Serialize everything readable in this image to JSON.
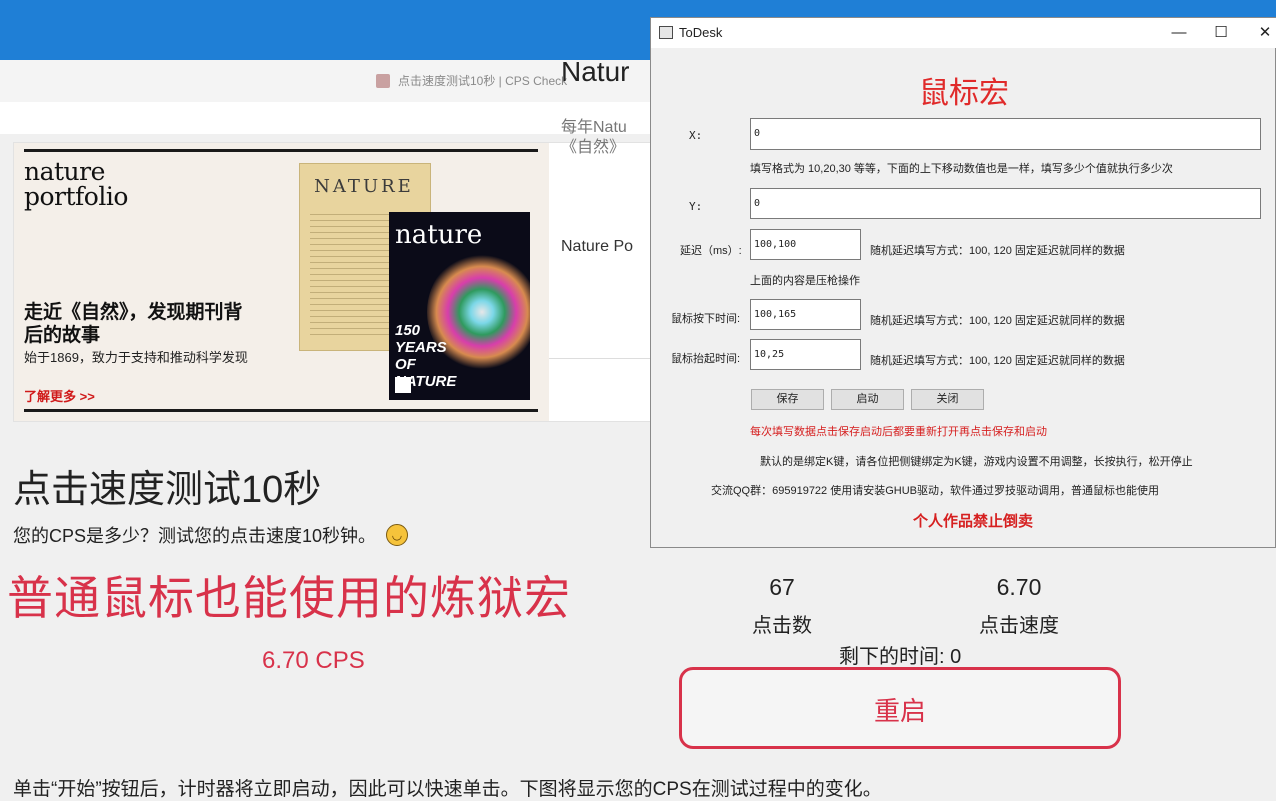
{
  "browser": {
    "tab_title": "点击速度测试10秒 | CPS Check"
  },
  "ad": {
    "logo_line1": "nature",
    "logo_line2": "portfolio",
    "headline": "走近《自然》，发现期刊背后的故事",
    "subtext": "始于1869，致力于支持和推动科学发现",
    "cta": "了解更多 >>",
    "old_cover_mast": "NATURE",
    "new_cover_logo": "nature",
    "new_cover_text": "150 YEARS OF NATURE",
    "right_title": "Natur",
    "right_sub_line1": "每年Natu",
    "right_sub_line2": "《自然》",
    "right_footer": "Nature Po"
  },
  "cps": {
    "title": "点击速度测试10秒",
    "description": "您的CPS是多少？测试您的点击速度10秒钟。",
    "overlay_text": "普通鼠标也能使用的炼狱宏",
    "result": "6.70 CPS",
    "clicks_value": "67",
    "clicks_label": "点击数",
    "speed_value": "6.70",
    "speed_label": "点击速度",
    "remaining": "剩下的时间: 0",
    "restart_label": "重启",
    "footer": "单击“开始”按钮后，计时器将立即启动，因此可以快速单击。下图将显示您的CPS在测试过程中的变化。"
  },
  "dialog": {
    "title": "ToDesk",
    "minimize": "—",
    "maximize": "☐",
    "close": "✕",
    "heading": "鼠标宏",
    "x_label": "X:",
    "x_value": "0",
    "x_hint": "填写格式为 10,20,30 等等，下面的上下移动数值也是一样，填写多少个值就执行多少次",
    "y_label": "Y:",
    "y_value": "0",
    "delay_label": "延迟（ms）:",
    "delay_value": "100,100",
    "delay_hint": "随机延迟填写方式：100, 120  固定延迟就同样的数据",
    "recoil_note": "上面的内容是压枪操作",
    "press_label": "鼠标按下时间:",
    "press_value": "100,165",
    "press_hint": "随机延迟填写方式：100, 120  固定延迟就同样的数据",
    "release_label": "鼠标抬起时间:",
    "release_value": "10,25",
    "release_hint": "随机延迟填写方式：100, 120  固定延迟就同样的数据",
    "save_label": "保存",
    "start_label": "启动",
    "close_label": "关闭",
    "warning": "每次填写数据点击保存启动后都要重新打开再点击保存和启动",
    "note1": "默认的是绑定K键，请各位把侧键绑定为K键，游戏内设置不用调整，长按执行，松开停止",
    "note2": "交流QQ群：695919722 使用请安装GHUB驱动，软件通过罗技驱动调用，普通鼠标也能使用",
    "forbid": "个人作品禁止倒卖"
  },
  "colors": {
    "accent_red": "#d8324a",
    "dialog_red": "#e02a2a",
    "desktop_blue": "#1f7fd6"
  }
}
